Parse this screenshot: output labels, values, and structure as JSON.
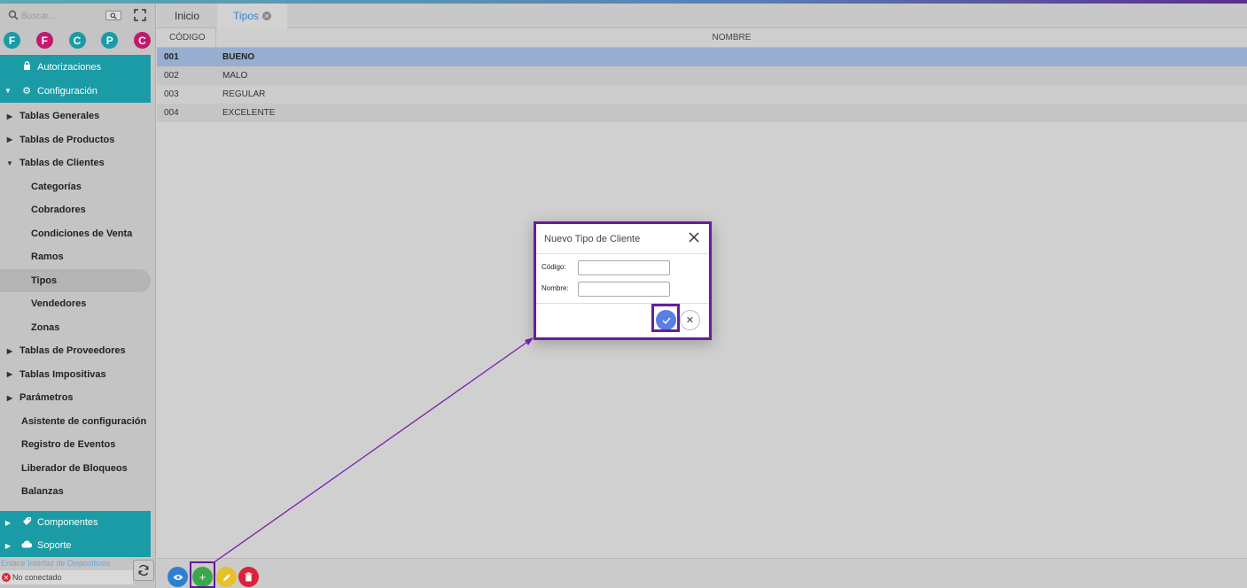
{
  "sidebar": {
    "search_placeholder": "Buscar...",
    "quick_buttons": [
      {
        "letter": "F",
        "color": "#1a9ba5"
      },
      {
        "letter": "F",
        "color": "#c4186e"
      },
      {
        "letter": "C",
        "color": "#1a9ba5"
      },
      {
        "letter": "P",
        "color": "#1a9ba5"
      },
      {
        "letter": "C",
        "color": "#c4186e"
      }
    ],
    "top_items": [
      {
        "label": "Autorizaciones",
        "icon": "lock-icon"
      },
      {
        "label": "Configuración",
        "icon": "gears-icon"
      }
    ],
    "tree": [
      {
        "label": "Tablas Generales",
        "type": "collapsed"
      },
      {
        "label": "Tablas de Productos",
        "type": "collapsed"
      },
      {
        "label": "Tablas de Clientes",
        "type": "expanded"
      },
      {
        "label": "Categorías",
        "type": "sub"
      },
      {
        "label": "Cobradores",
        "type": "sub"
      },
      {
        "label": "Condiciones de Venta",
        "type": "sub"
      },
      {
        "label": "Ramos",
        "type": "sub"
      },
      {
        "label": "Tipos",
        "type": "sub-active"
      },
      {
        "label": "Vendedores",
        "type": "sub"
      },
      {
        "label": "Zonas",
        "type": "sub"
      },
      {
        "label": "Tablas de Proveedores",
        "type": "collapsed"
      },
      {
        "label": "Tablas Impositivas",
        "type": "collapsed"
      },
      {
        "label": "Parámetros",
        "type": "collapsed"
      },
      {
        "label": "Asistente de configuración",
        "type": "plain"
      },
      {
        "label": "Registro de Eventos",
        "type": "plain"
      },
      {
        "label": "Liberador de Bloqueos",
        "type": "plain"
      },
      {
        "label": "Balanzas",
        "type": "plain"
      }
    ],
    "bottom_items": [
      {
        "label": "Componentes",
        "icon": "tag-icon"
      },
      {
        "label": "Soporte",
        "icon": "cloud-icon"
      }
    ],
    "device_link": "Enlace Interfaz de Dispositivos",
    "device_status": "No conectado"
  },
  "tabs": [
    {
      "label": "Inicio",
      "active": false
    },
    {
      "label": "Tipos",
      "active": true
    }
  ],
  "table": {
    "headers": {
      "code": "CÓDIGO",
      "name": "NOMBRE"
    },
    "rows": [
      {
        "code": "001",
        "name": "BUENO"
      },
      {
        "code": "002",
        "name": "MALO"
      },
      {
        "code": "003",
        "name": "REGULAR"
      },
      {
        "code": "004",
        "name": "EXCELENTE"
      }
    ]
  },
  "toolbar": {
    "view_color": "#2f7fd0",
    "add_color": "#3aa84a",
    "edit_color": "#e8c12a",
    "delete_color": "#d9243a"
  },
  "dialog": {
    "title": "Nuevo Tipo de Cliente",
    "code_label": "Código:",
    "name_label": "Nombre:",
    "code_value": "",
    "name_value": ""
  },
  "colors": {
    "accent_teal": "#1a9ba5",
    "highlight_purple": "#6a1d9a"
  }
}
